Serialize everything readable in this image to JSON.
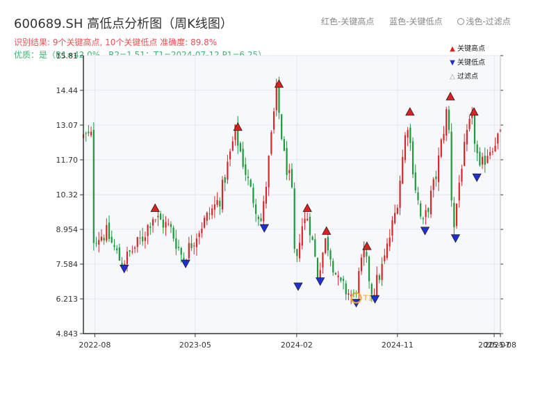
{
  "title": "600689.SH 高低点分析图（周K线图）",
  "summary": "识别结果: 9个关键高点, 10个关键低点   准确度: 89.8%",
  "quality": "优质：是（R1=42.0%，R2=1.51；T1=2024-07-12 P1=6.25）",
  "top_legend": {
    "high": "红色-关键高点",
    "low": "蓝色-关键低点",
    "filtered": "浅色-过滤点"
  },
  "legend": [
    {
      "glyph": "▲",
      "color": "#e02020",
      "label": "关键高点"
    },
    {
      "glyph": "▼",
      "color": "#1f2fd6",
      "label": "关键低点"
    },
    {
      "glyph": "△",
      "color": "#999999",
      "label": "过滤点"
    }
  ],
  "colors": {
    "up": "#d62728",
    "down": "#1a9a3a",
    "high_marker": "#e02020",
    "low_marker": "#1f2fd6",
    "t1": "#f5a623",
    "grid": "#e3e7ee",
    "plot_bg": "#f7f8fb",
    "axis": "#333333"
  },
  "chart_data": {
    "type": "candlestick",
    "x_start": "2022-07-01",
    "x_end": "2025-08-08",
    "xticks": [
      {
        "date": "2022-08-01",
        "label": "2022-08"
      },
      {
        "date": "2023-05-01",
        "label": "2023-05"
      },
      {
        "date": "2024-02-01",
        "label": "2024-02"
      },
      {
        "date": "2024-11-01",
        "label": "2024-11"
      },
      {
        "date": "2025-07-22",
        "label": "2025-07"
      },
      {
        "date": "2025-08-08",
        "label": "2025-08"
      }
    ],
    "ylim": [
      4.843,
      15.81
    ],
    "yticks": [
      "4.843",
      "6.213",
      "7.584",
      "8.954",
      "10.32",
      "11.70",
      "13.07",
      "14.44",
      "15.81"
    ],
    "key_prices": [
      {
        "t": "2022-08-01",
        "p": 8.6
      },
      {
        "t": "2022-09-10",
        "p": 8.8
      },
      {
        "t": "2022-10-20",
        "p": 7.6
      },
      {
        "t": "2022-12-15",
        "p": 8.6
      },
      {
        "t": "2023-01-12",
        "p": 9.5
      },
      {
        "t": "2023-03-01",
        "p": 9.0
      },
      {
        "t": "2023-04-05",
        "p": 7.8
      },
      {
        "t": "2023-05-20",
        "p": 9.0
      },
      {
        "t": "2023-07-15",
        "p": 10.2
      },
      {
        "t": "2023-08-25",
        "p": 12.8
      },
      {
        "t": "2023-10-05",
        "p": 10.5
      },
      {
        "t": "2023-11-05",
        "p": 9.2
      },
      {
        "t": "2023-12-15",
        "p": 14.4
      },
      {
        "t": "2024-01-05",
        "p": 11.8
      },
      {
        "t": "2024-01-25",
        "p": 10.6
      },
      {
        "t": "2024-02-05",
        "p": 7.0
      },
      {
        "t": "2024-02-18",
        "p": 9.0
      },
      {
        "t": "2024-03-10",
        "p": 9.5
      },
      {
        "t": "2024-04-05",
        "p": 7.2
      },
      {
        "t": "2024-04-28",
        "p": 8.6
      },
      {
        "t": "2024-06-01",
        "p": 6.8
      },
      {
        "t": "2024-07-12",
        "p": 6.25
      },
      {
        "t": "2024-08-10",
        "p": 8.0
      },
      {
        "t": "2024-09-01",
        "p": 6.4
      },
      {
        "t": "2024-10-01",
        "p": 7.6
      },
      {
        "t": "2024-11-05",
        "p": 9.8
      },
      {
        "t": "2024-12-05",
        "p": 13.3
      },
      {
        "t": "2024-12-25",
        "p": 10.8
      },
      {
        "t": "2025-01-15",
        "p": 9.0
      },
      {
        "t": "2025-02-20",
        "p": 11.0
      },
      {
        "t": "2025-03-25",
        "p": 13.9
      },
      {
        "t": "2025-04-08",
        "p": 8.8
      },
      {
        "t": "2025-05-01",
        "p": 11.5
      },
      {
        "t": "2025-05-28",
        "p": 13.4
      },
      {
        "t": "2025-06-20",
        "p": 11.2
      },
      {
        "t": "2025-07-10",
        "p": 12.0
      },
      {
        "t": "2025-08-08",
        "p": 12.6
      }
    ],
    "key_highs": [
      {
        "t": "2023-01-12",
        "p": 9.6
      },
      {
        "t": "2023-08-25",
        "p": 12.8
      },
      {
        "t": "2023-12-15",
        "p": 14.5
      },
      {
        "t": "2024-03-01",
        "p": 9.6
      },
      {
        "t": "2024-04-22",
        "p": 8.7
      },
      {
        "t": "2024-08-10",
        "p": 8.1
      },
      {
        "t": "2024-12-05",
        "p": 13.4
      },
      {
        "t": "2025-03-25",
        "p": 14.0
      },
      {
        "t": "2025-05-28",
        "p": 13.4
      }
    ],
    "key_lows": [
      {
        "t": "2022-10-20",
        "p": 7.6
      },
      {
        "t": "2023-04-05",
        "p": 7.8
      },
      {
        "t": "2023-11-05",
        "p": 9.2
      },
      {
        "t": "2024-02-05",
        "p": 6.9
      },
      {
        "t": "2024-04-05",
        "p": 7.1
      },
      {
        "t": "2024-07-12",
        "p": 6.25
      },
      {
        "t": "2024-09-01",
        "p": 6.4
      },
      {
        "t": "2025-01-15",
        "p": 9.1
      },
      {
        "t": "2025-04-08",
        "p": 8.8
      },
      {
        "t": "2025-06-05",
        "p": 11.2
      }
    ],
    "t1": {
      "date": "2024-07-12",
      "price": 6.25,
      "label": "T1"
    }
  }
}
